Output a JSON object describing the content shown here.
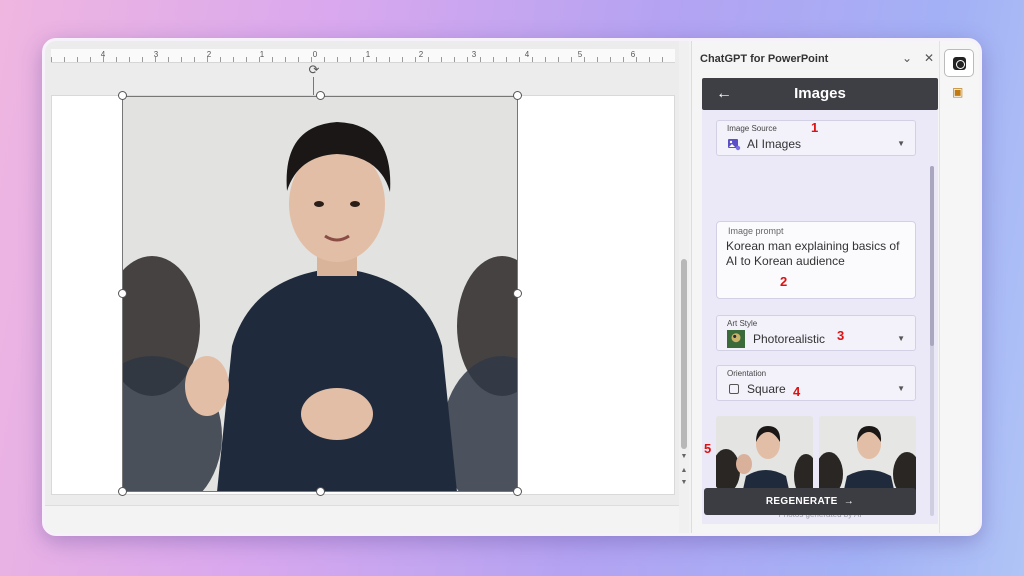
{
  "ruler": {
    "labels": [
      "4",
      "3",
      "2",
      "1",
      "0",
      "1",
      "2",
      "3",
      "4",
      "5",
      "6"
    ]
  },
  "pane": {
    "app_title": "ChatGPT for PowerPoint",
    "header_title": "Images",
    "image_source": {
      "label": "Image Source",
      "value": "AI Images",
      "marker": "1"
    },
    "prompt": {
      "label": "Image prompt",
      "value": "Korean man explaining basics of AI to Korean audience",
      "marker": "2"
    },
    "art_style": {
      "label": "Art Style",
      "value": "Photorealistic",
      "marker": "3"
    },
    "orientation": {
      "label": "Orientation",
      "value": "Square",
      "marker": "4"
    },
    "thumbnails_marker": "5",
    "generated_note": "Photos generated by AI",
    "regenerate_label": "REGENERATE"
  },
  "colors": {
    "accent_dark": "#3e3f45",
    "marker_red": "#d11111",
    "pane_bg": "#ebe9f7"
  },
  "icons": {
    "back": "arrow-left-icon",
    "close": "close-icon",
    "collapse": "chevron-down-icon",
    "regenerate": "arrow-right-icon"
  }
}
